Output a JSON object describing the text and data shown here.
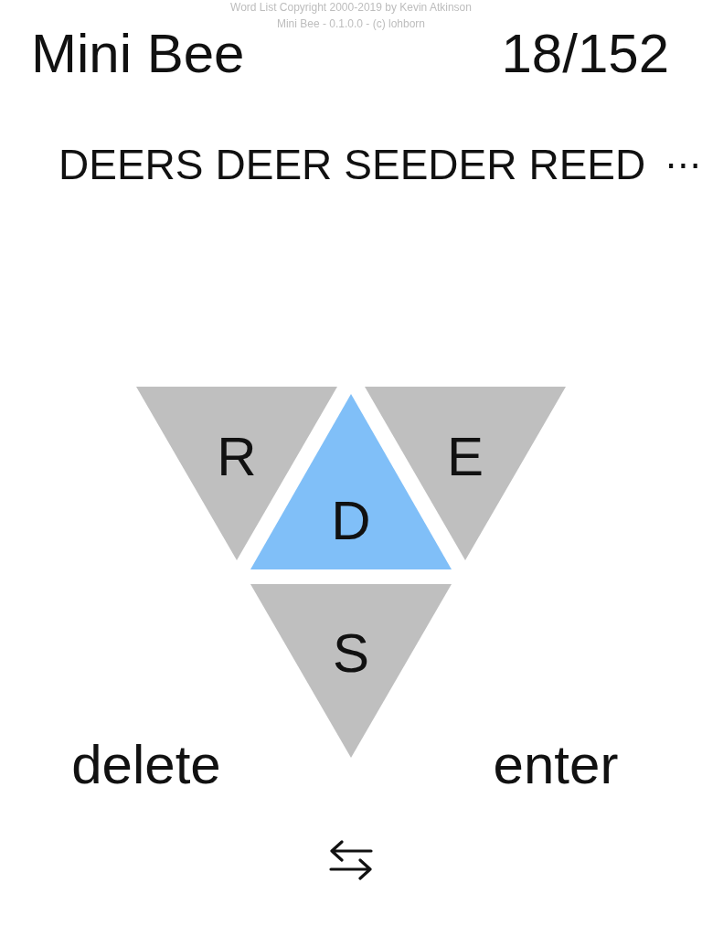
{
  "credits": [
    "Word List Copyright 2000-2019 by Kevin Atkinson",
    "Mini Bee - 0.1.0.0 - (c) lohborn"
  ],
  "header": {
    "title": "Mini Bee",
    "score": "18/152"
  },
  "found_words": {
    "words": [
      "DEERS",
      "DEER",
      "SEEDER",
      "REED"
    ],
    "more": "⋯"
  },
  "tiles": [
    {
      "letter": "R",
      "kind": "outer"
    },
    {
      "letter": "D",
      "kind": "center"
    },
    {
      "letter": "E",
      "kind": "outer"
    },
    {
      "letter": "S",
      "kind": "outer"
    }
  ],
  "actions": [
    {
      "label": "delete"
    },
    {
      "label": "enter"
    }
  ]
}
